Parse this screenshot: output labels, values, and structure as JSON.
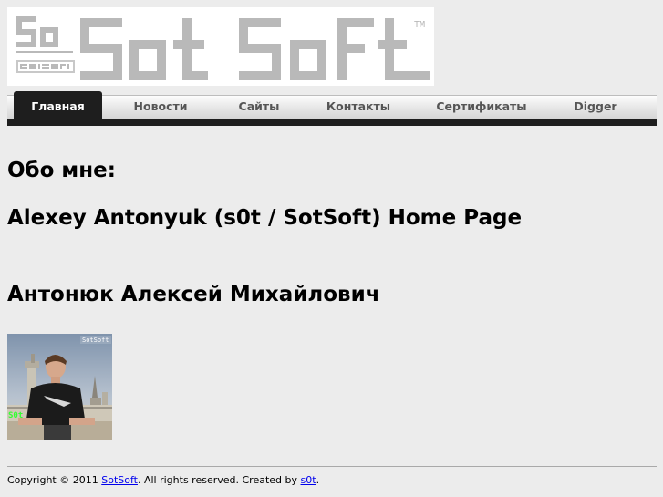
{
  "logo": {
    "wordmark": "SotSoft",
    "small_mark": "SotSoft",
    "tm": "TM"
  },
  "nav": {
    "items": [
      {
        "label": "Главная",
        "active": true
      },
      {
        "label": "Новости",
        "active": false
      },
      {
        "label": "Сайты",
        "active": false
      },
      {
        "label": "Контакты",
        "active": false
      },
      {
        "label": "Сертификаты",
        "active": false
      },
      {
        "label": "Digger",
        "active": false
      }
    ]
  },
  "content": {
    "about_heading": "Обо мне:",
    "homepage_title": "Alexey Antonyuk (s0t / SotSoft) Home Page",
    "full_name": "Антонюк Алексей Михайлович",
    "photo": {
      "watermark": "SotSoft",
      "tag": "S0t"
    }
  },
  "footer": {
    "copyright": "Copyright © 2011 ",
    "sotsoft_link": "SotSoft",
    "rights": ". All rights reserved. Created by ",
    "author_link": "s0t",
    "end": "."
  },
  "colors": {
    "page_bg": "#ececec",
    "nav_active_bg": "#1e1e1e",
    "logo_glyph": "#b9b9b9",
    "link": "#0000ee"
  }
}
